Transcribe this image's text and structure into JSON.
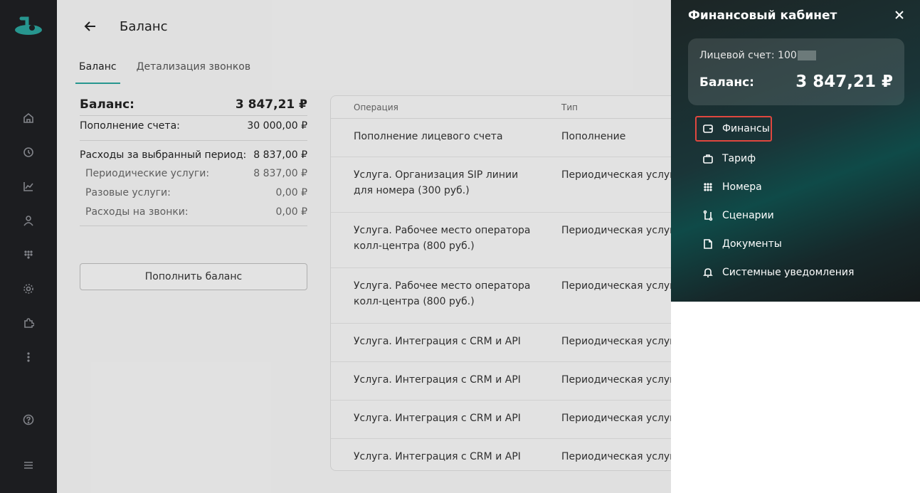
{
  "page": {
    "title": "Баланс"
  },
  "tabs": [
    {
      "label": "Баланс",
      "active": true
    },
    {
      "label": "Детализация звонков",
      "active": false
    }
  ],
  "summary": {
    "balance_label": "Баланс:",
    "balance_value": "3 847,21 ₽",
    "topup_label": "Пополнение счета:",
    "topup_value": "30 000,00 ₽",
    "expenses_label": "Расходы за выбранный период:",
    "expenses_value": "8 837,00 ₽",
    "periodic_label": "Периодические услуги:",
    "periodic_value": "8 837,00 ₽",
    "oneoff_label": "Разовые услуги:",
    "oneoff_value": "0,00 ₽",
    "calls_label": "Расходы на звонки:",
    "calls_value": "0,00 ₽"
  },
  "topup_button": "Пополнить баланс",
  "table": {
    "headers": {
      "operation": "Операция",
      "type": "Тип"
    },
    "rows": [
      {
        "operation": "Пополнение лицевого счета",
        "type": "Пополнение"
      },
      {
        "operation": "Услуга. Организация SIP линии для номера (300 руб.)",
        "type": "Периодическая услуга"
      },
      {
        "operation": "Услуга. Рабочее место оператора колл-центра (800 руб.)",
        "type": "Периодическая услуга"
      },
      {
        "operation": "Услуга. Рабочее место оператора колл-центра (800 руб.)",
        "type": "Периодическая услуга"
      },
      {
        "operation": "Услуга. Интеграция с CRM и API",
        "type": "Периодическая услуга"
      },
      {
        "operation": "Услуга. Интеграция с CRM и API",
        "type": "Периодическая услуга"
      },
      {
        "operation": "Услуга. Интеграция с CRM и API",
        "type": "Периодическая услуга"
      },
      {
        "operation": "Услуга. Интеграция с CRM и API",
        "type": "Периодическая услуга"
      }
    ]
  },
  "panel": {
    "title": "Финансовый кабинет",
    "account_label": "Лицевой счет: 100",
    "balance_label": "Баланс:",
    "balance_value": "3 847,21 ₽",
    "menu": [
      {
        "label": "Финансы",
        "icon": "wallet-icon"
      },
      {
        "label": "Тариф",
        "icon": "briefcase-icon"
      },
      {
        "label": "Номера",
        "icon": "dialpad-icon"
      },
      {
        "label": "Сценарии",
        "icon": "flow-icon"
      },
      {
        "label": "Документы",
        "icon": "document-icon"
      },
      {
        "label": "Системные уведомления",
        "icon": "bell-icon"
      }
    ]
  },
  "colors": {
    "accent": "#2ba39c",
    "highlight": "#e0473f",
    "rail": "#1f2023"
  }
}
